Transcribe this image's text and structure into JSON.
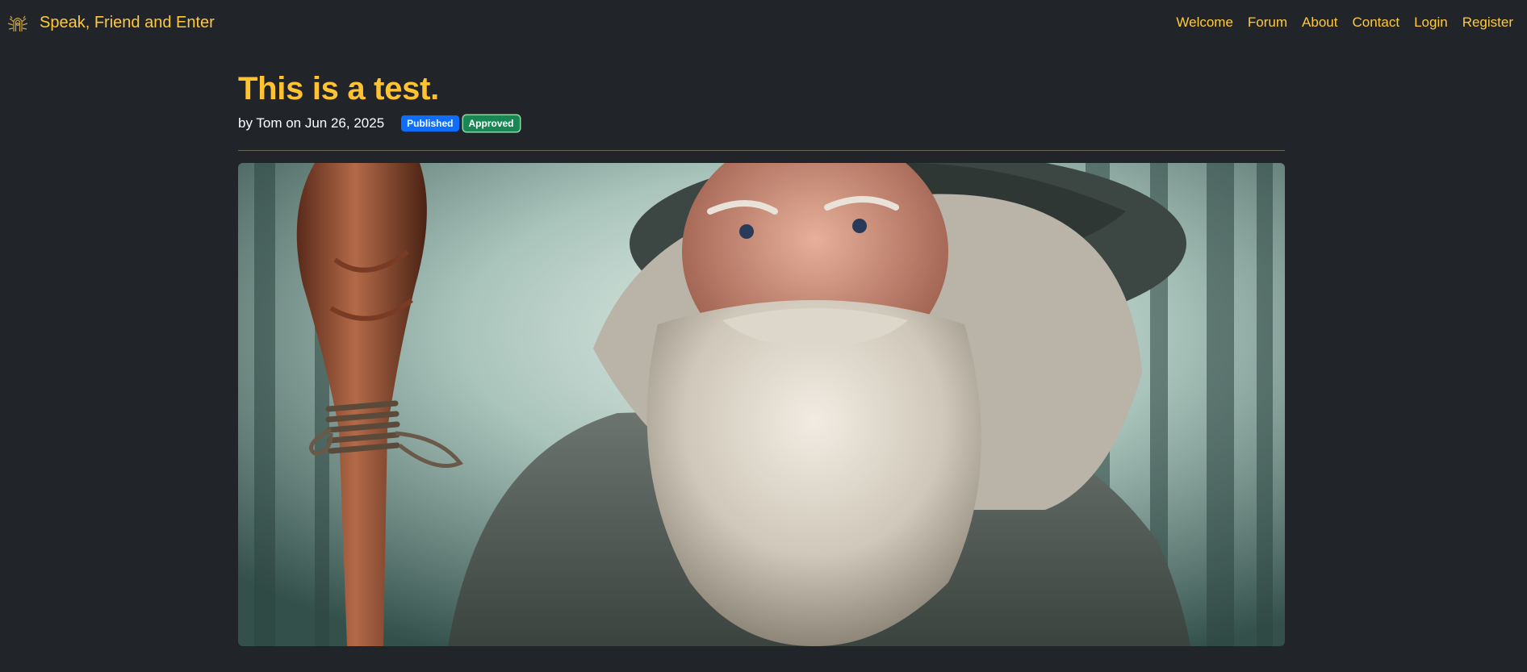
{
  "navbar": {
    "brand_label": "Speak, Friend and Enter",
    "brand_icon": "elven-door-logo-icon",
    "links": [
      {
        "label": "Welcome"
      },
      {
        "label": "Forum"
      },
      {
        "label": "About"
      },
      {
        "label": "Contact"
      },
      {
        "label": "Login"
      },
      {
        "label": "Register"
      }
    ]
  },
  "post": {
    "title": "This is a test.",
    "byline": "by Tom on Jun 26, 2025",
    "badges": {
      "published": "Published",
      "approved": "Approved"
    },
    "image_alt": "wizard with staff in misty forest"
  },
  "colors": {
    "background": "#212529",
    "accent": "#ffc232",
    "badge_published": "#0d6efd",
    "badge_approved": "#198754"
  }
}
